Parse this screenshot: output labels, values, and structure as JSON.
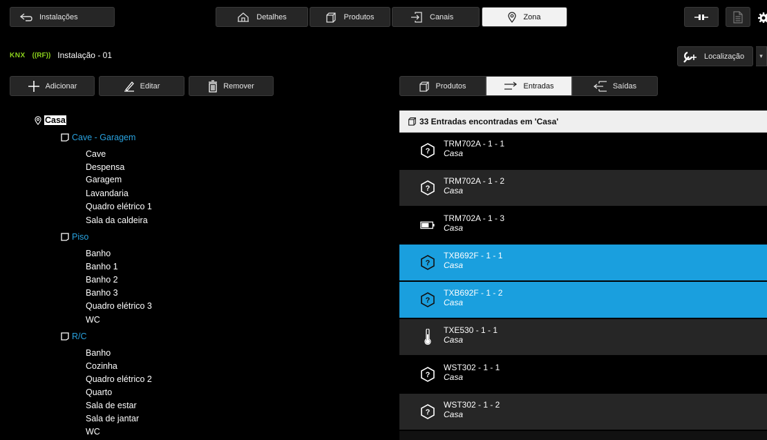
{
  "topbar": {
    "back_label": "Instalações",
    "tabs": [
      {
        "label": "Detalhes",
        "icon": "home-icon"
      },
      {
        "label": "Produtos",
        "icon": "cube-icon"
      },
      {
        "label": "Canais",
        "icon": "channel-icon"
      },
      {
        "label": "Zona",
        "icon": "location-pin-icon",
        "active": true
      }
    ]
  },
  "installation": {
    "protocol_knx": "KNX",
    "protocol_rf": "((RF))",
    "name": "Instalação - 01"
  },
  "location_button": {
    "label": "Localização"
  },
  "actions": {
    "add_label": "Adicionar",
    "edit_label": "Editar",
    "remove_label": "Remover"
  },
  "subtabs": [
    {
      "label": "Produtos"
    },
    {
      "label": "Entradas",
      "active": true
    },
    {
      "label": "Saídas"
    }
  ],
  "tree": {
    "root": "Casa",
    "groups": [
      {
        "label": "Cave - Garagem",
        "items": [
          "Cave",
          "Despensa",
          "Garagem",
          "Lavandaria",
          "Quadro elétrico 1",
          "Sala da caldeira"
        ]
      },
      {
        "label": "Piso",
        "items": [
          "Banho",
          "Banho 1",
          "Banho 2",
          "Banho 3",
          "Quadro elétrico 3",
          "WC"
        ]
      },
      {
        "label": "R/C",
        "items": [
          "Banho",
          "Cozinha",
          "Quadro elétrico 2",
          "Quarto",
          "Sala de estar",
          "Sala de jantar",
          "WC"
        ]
      }
    ]
  },
  "inputs_list": {
    "header": "33 Entradas encontradas em 'Casa'",
    "rows": [
      {
        "name": "TRM702A - 1 - 1",
        "location": "Casa",
        "icon": "unknown-device-icon",
        "style": "dark"
      },
      {
        "name": "TRM702A - 1 - 2",
        "location": "Casa",
        "icon": "unknown-device-icon",
        "style": "gray"
      },
      {
        "name": "TRM702A - 1 - 3",
        "location": "Casa",
        "icon": "battery-icon",
        "style": "dark"
      },
      {
        "name": "TXB692F - 1 - 1",
        "location": "Casa",
        "icon": "unknown-device-icon",
        "style": "sel"
      },
      {
        "name": "TXB692F - 1 - 2",
        "location": "Casa",
        "icon": "unknown-device-icon",
        "style": "sel"
      },
      {
        "name": "TXE530 - 1 - 1",
        "location": "Casa",
        "icon": "thermometer-icon",
        "style": "gray"
      },
      {
        "name": "WST302 - 1 - 1",
        "location": "Casa",
        "icon": "unknown-device-icon",
        "style": "dark"
      },
      {
        "name": "WST302 - 1 - 2",
        "location": "Casa",
        "icon": "unknown-device-icon",
        "style": "gray"
      }
    ]
  },
  "colors": {
    "accent": "#1a9fde",
    "group_blue": "#29a3e0",
    "knx_green": "#8bd11c"
  }
}
